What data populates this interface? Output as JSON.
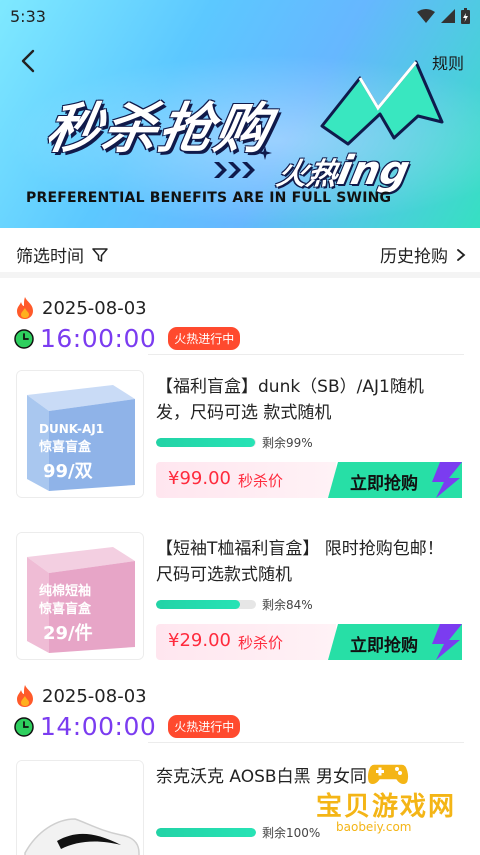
{
  "status_bar": {
    "time": "5:33"
  },
  "header": {
    "rules_label": "规则"
  },
  "banner": {
    "title": "秒杀抢购",
    "hot_text": "火热",
    "ing_text": "ing",
    "subtitle": "PREFERENTIAL BENEFITS ARE IN FULL SWING"
  },
  "filter": {
    "time_label": "筛选时间",
    "history_label": "历史抢购"
  },
  "sessions": [
    {
      "date": "2025-08-03",
      "time": "16:00:00",
      "badge": "火热进行中",
      "products": [
        {
          "title": "【福利盲盒】dunk（SB）/AJ1随机发，尺码可选 款式随机",
          "stock_text": "剩余99%",
          "stock_fraction": 0.99,
          "price": "¥99.00",
          "price_label": "秒杀价",
          "buy_label": "立即抢购",
          "thumb": {
            "line1": "DUNK-AJ1",
            "line2": "惊喜盲盒",
            "price": "99/双",
            "color": "#8fb3e8"
          }
        },
        {
          "title": "【短袖T桖福利盲盒】 限时抢购包邮！尺码可选款式随机",
          "stock_text": "剩余84%",
          "stock_fraction": 0.84,
          "price": "¥29.00",
          "price_label": "秒杀价",
          "buy_label": "立即抢购",
          "thumb": {
            "line1": "纯棉短袖",
            "line2": "惊喜盲盒",
            "price": "29/件",
            "color": "#e7a5c7"
          }
        }
      ]
    },
    {
      "date": "2025-08-03",
      "time": "14:00:00",
      "badge": "火热进行中",
      "products": [
        {
          "title": "奈克沃克 AOSB白黑 男女同",
          "stock_text": "剩余100%",
          "stock_fraction": 1.0
        }
      ]
    }
  ],
  "watermark": {
    "name": "宝贝游戏网",
    "url": "baobeiy.com"
  },
  "colors": {
    "accent_purple": "#7b3cf0",
    "price_red": "#ff2b3d",
    "buy_green": "#27dfa6",
    "badge_red": "#ff4a2e"
  }
}
